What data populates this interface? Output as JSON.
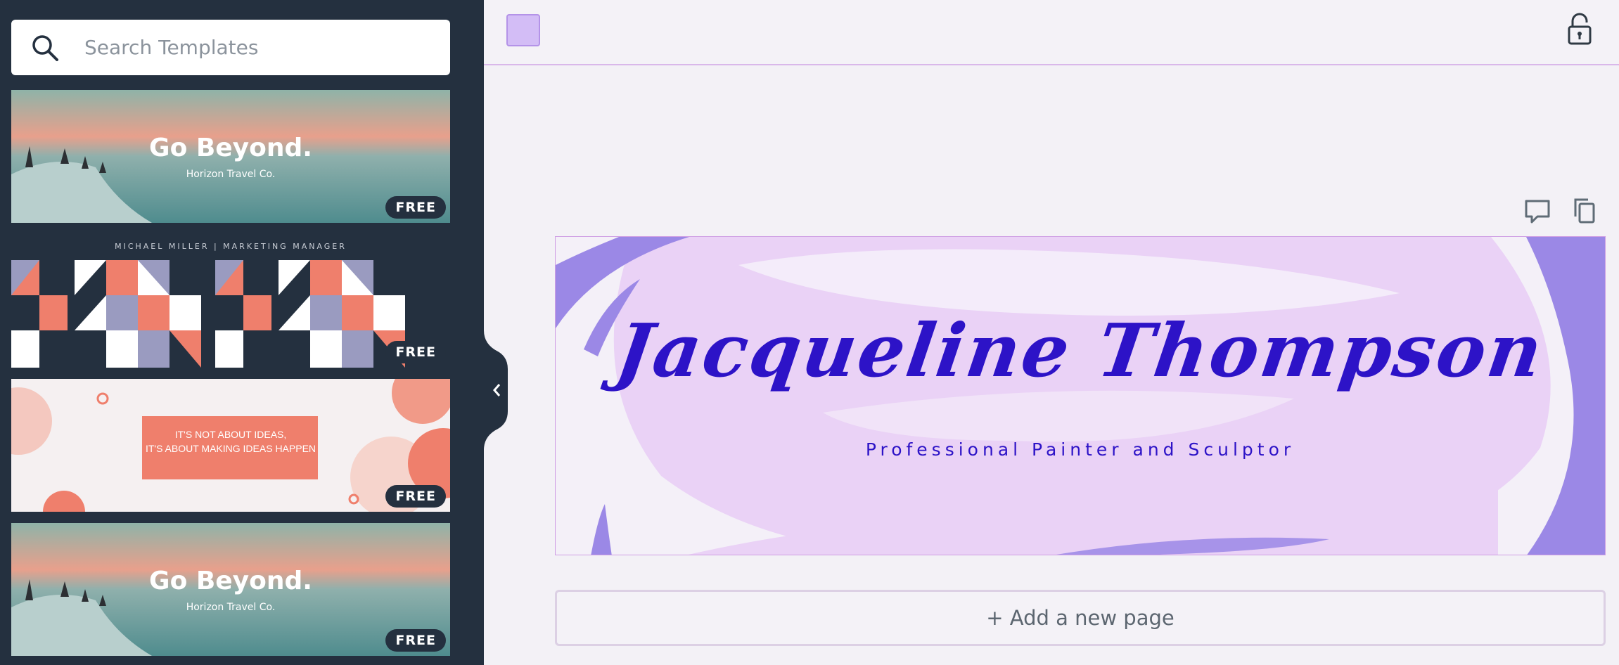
{
  "search": {
    "placeholder": "Search Templates"
  },
  "sidebar": {
    "templates": [
      {
        "title": "Go Beyond.",
        "subtitle": "Horizon Travel Co.",
        "badge": "FREE"
      },
      {
        "header": "MICHAEL MILLER  |  MARKETING MANAGER",
        "badge": "FREE"
      },
      {
        "line1": "IT'S NOT ABOUT IDEAS,",
        "line2": "IT'S ABOUT MAKING IDEAS HAPPEN",
        "badge": "FREE"
      },
      {
        "title": "Go Beyond.",
        "subtitle": "Horizon Travel Co.",
        "badge": "FREE"
      }
    ]
  },
  "toolbar": {
    "swatch_color": "#d3bdf6"
  },
  "canvas": {
    "name": "Jacqueline Thompson",
    "subtitle": "Professional Painter and Sculptor"
  },
  "add_page": {
    "label": "+ Add a new page"
  },
  "colors": {
    "sidebar_bg": "#24303f",
    "accent_text": "#2d13c7",
    "lilac": "#e8d2f6",
    "violet": "#9b88e6",
    "coral": "#ef7f6c"
  },
  "icons": [
    "search-icon",
    "chevron-left-icon",
    "lock-icon",
    "comment-icon",
    "duplicate-icon"
  ]
}
